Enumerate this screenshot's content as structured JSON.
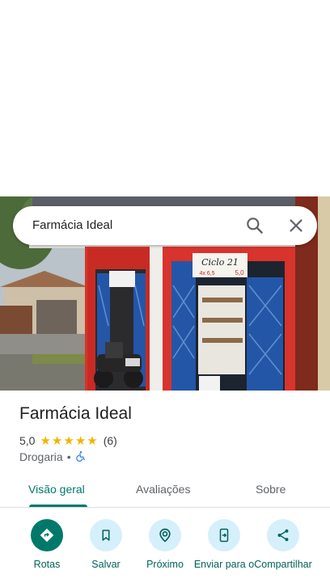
{
  "search": {
    "query": "Farmácia Ideal"
  },
  "place": {
    "name": "Farmácia Ideal",
    "rating": "5,0",
    "stars": 5,
    "review_count": "(6)",
    "category": "Drogaria",
    "separator": "•",
    "accessibility_icon": "wheelchair-icon"
  },
  "photo": {
    "sign_text": "Ciclo 21",
    "sign_small_left": "4x 6,5",
    "sign_small_right": "5,0"
  },
  "tabs": [
    {
      "label": "Visão geral"
    },
    {
      "label": "Avaliações"
    },
    {
      "label": "Sobre"
    }
  ],
  "actions": [
    {
      "label": "Rotas",
      "icon": "directions-icon"
    },
    {
      "label": "Salvar",
      "icon": "bookmark-icon"
    },
    {
      "label": "Próximo",
      "icon": "nearby-icon"
    },
    {
      "label": "Enviar para o",
      "icon": "send-to-phone-icon"
    },
    {
      "label": "Compartilhar",
      "icon": "share-icon"
    }
  ],
  "colors": {
    "accent": "#00796b",
    "star": "#f4b400",
    "action_bg": "#d5f0fa"
  }
}
